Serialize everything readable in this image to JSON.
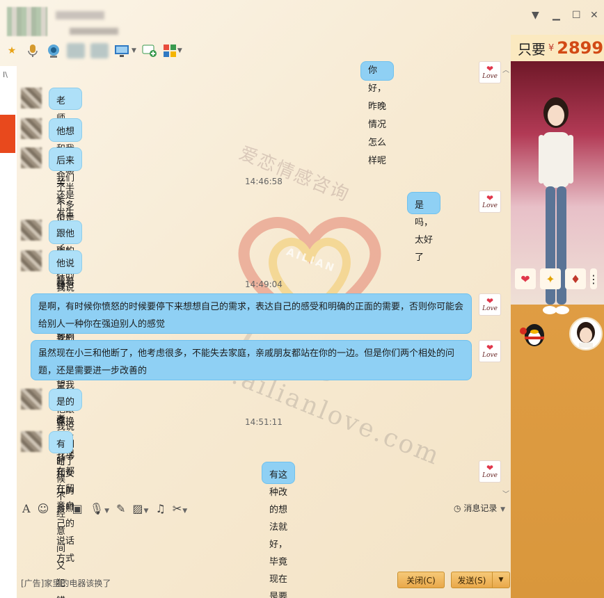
{
  "window": {
    "controls": {
      "menu": "▼",
      "minimize": "▁",
      "maximize": "☐",
      "close": "✕"
    },
    "left_strip_text": "I\\"
  },
  "toolbar": {
    "icons": [
      "star-icon",
      "microphone-icon",
      "camera-icon",
      "screen-share-icon",
      "new-chat-icon",
      "apps-icon"
    ]
  },
  "chat": {
    "messages": [
      {
        "side": "out",
        "text": "你好，昨晚情况怎么样呢"
      },
      {
        "side": "in",
        "text": "老师，昨晚我们又聊了半个多小时，是这样的"
      },
      {
        "side": "in",
        "text": "他想和我发生关系，但是我拒绝了，我说你要和小三彻底断掉才行，他跟我说他们断了"
      },
      {
        "side": "in",
        "text": "后来我们还是发生关系了，他给我看了手机，他删除了小三，把头像换成了儿子和女儿的合照"
      },
      {
        "side": "time",
        "text": "14:46:58"
      },
      {
        "side": "out",
        "text": "是吗，太好了"
      },
      {
        "side": "in",
        "text": "跟他聊的时候，还聊了下我们以前"
      },
      {
        "side": "in",
        "text": "他说我总是喜欢命令他，他希望我能改改"
      },
      {
        "side": "time",
        "text": "14:49:04"
      },
      {
        "side": "out",
        "line1": "是啊，有时候你愤怒的时候要停下来想想自己的需求，表达自己的感受和明确的正面的需要，否则你可能会",
        "line2": "给别人一种你在强迫别人的感觉"
      },
      {
        "side": "out",
        "line1": "虽然现在小三和他断了，他考虑很多，不能失去家庭，亲戚朋友都站在你的一边。但是你们两个相处的问",
        "line2": "题，还是需要进一步改善的"
      },
      {
        "side": "in",
        "text": "是的老师，我现在都在留意自己的说话方式"
      },
      {
        "side": "time",
        "text": "14:51:11"
      },
      {
        "side": "in",
        "text": "有时候不经意间又犯错了"
      },
      {
        "side": "out",
        "text": "有这种改的想法就好，毕竟现在是要转变思维模式"
      }
    ],
    "love_badge": "Love"
  },
  "watermarks": {
    "cn": "爱恋情感咨询",
    "brand": "AILIAN",
    "script": "Love",
    "url": "www.ailianlove.com"
  },
  "input": {
    "history_label": "消息记录",
    "ad_text": "[广告]家里的电器该换了",
    "close_label": "关闭(C)",
    "send_label": "发送(S)"
  },
  "right_panel": {
    "ad_prefix": "只要",
    "currency": "¥",
    "price": "2899"
  }
}
